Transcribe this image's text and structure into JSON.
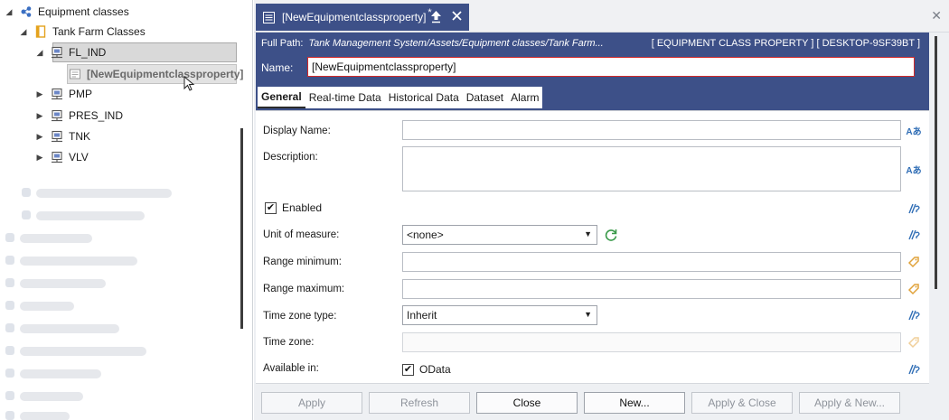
{
  "tree": {
    "root": {
      "label": "Equipment classes",
      "icon": "equipment-classes-icon"
    },
    "folder": {
      "label": "Tank Farm Classes",
      "icon": "folder-icon"
    },
    "items": [
      {
        "label": "FL_IND",
        "icon": "device-icon"
      },
      {
        "label": "[NewEquipmentclassproperty]",
        "icon": "property-icon"
      },
      {
        "label": "PMP",
        "icon": "device-icon"
      },
      {
        "label": "PRES_IND",
        "icon": "device-icon"
      },
      {
        "label": "TNK",
        "icon": "device-icon"
      },
      {
        "label": "VLV",
        "icon": "device-icon"
      }
    ]
  },
  "document": {
    "tab_title": "[NewEquipmentclassproperty]",
    "tab_modified": "*",
    "full_path_label": "Full Path:",
    "full_path_value": "Tank Management System/Assets/Equipment classes/Tank Farm...",
    "full_path_right": "[ EQUIPMENT CLASS PROPERTY ] [ DESKTOP-9SF39BT ]",
    "name_label": "Name:",
    "name_value": "[NewEquipmentclassproperty]",
    "tabs": [
      "General",
      "Real-time Data",
      "Historical Data",
      "Dataset",
      "Alarm"
    ],
    "active_tab": "General"
  },
  "form": {
    "display_name_label": "Display Name:",
    "display_name_value": "",
    "description_label": "Description:",
    "description_value": "",
    "enabled_label": "Enabled",
    "enabled_checked": true,
    "unit_label": "Unit of measure:",
    "unit_value": "<none>",
    "range_min_label": "Range minimum:",
    "range_min_value": "",
    "range_max_label": "Range maximum:",
    "range_max_value": "",
    "tz_type_label": "Time zone type:",
    "tz_type_value": "Inherit",
    "tz_label": "Time zone:",
    "tz_value": "",
    "available_label": "Available in:",
    "odata_label": "OData",
    "odata_checked": true,
    "aa_icon_text": "Aあ"
  },
  "buttons": {
    "apply": "Apply",
    "refresh": "Refresh",
    "close": "Close",
    "new": "New...",
    "apply_close": "Apply & Close",
    "apply_new": "Apply & New..."
  },
  "colors": {
    "header_band": "#3d5088",
    "name_border": "#d22a2a",
    "link_icon": "#2f6db5",
    "tag_icon": "#e0a23a",
    "refresh_icon": "#3a9a4a"
  }
}
